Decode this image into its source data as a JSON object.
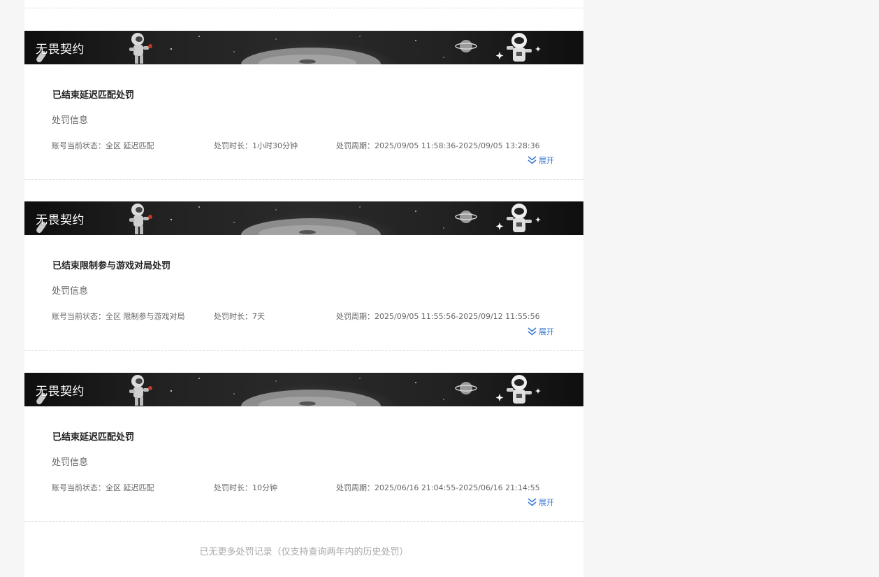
{
  "records": [
    {
      "banner_title": "无畏契约",
      "title": "已结束延迟匹配处罚",
      "subtitle": "处罚信息",
      "status": "账号当前状态：全区 延迟匹配",
      "duration": "处罚时长：1小时30分钟",
      "period": "处罚周期：2025/09/05 11:58:36-2025/09/05 13:28:36",
      "expand_label": "展开"
    },
    {
      "banner_title": "无畏契约",
      "title": "已结束限制参与游戏对局处罚",
      "subtitle": "处罚信息",
      "status": "账号当前状态：全区 限制参与游戏对局",
      "duration": "处罚时长：7天",
      "period": "处罚周期：2025/09/05 11:55:56-2025/09/12 11:55:56",
      "expand_label": "展开"
    },
    {
      "banner_title": "无畏契约",
      "title": "已结束延迟匹配处罚",
      "subtitle": "处罚信息",
      "status": "账号当前状态：全区 延迟匹配",
      "duration": "处罚时长：10分钟",
      "period": "处罚周期：2025/06/16 21:04:55-2025/06/16 21:14:55",
      "expand_label": "展开"
    }
  ],
  "footer_note": "已无更多处罚记录（仅支持查询两年内的历史处罚）",
  "colors": {
    "link": "#3a7bd5",
    "page_background": "#f6f6f6",
    "banner_background": "#1a1a1a"
  }
}
